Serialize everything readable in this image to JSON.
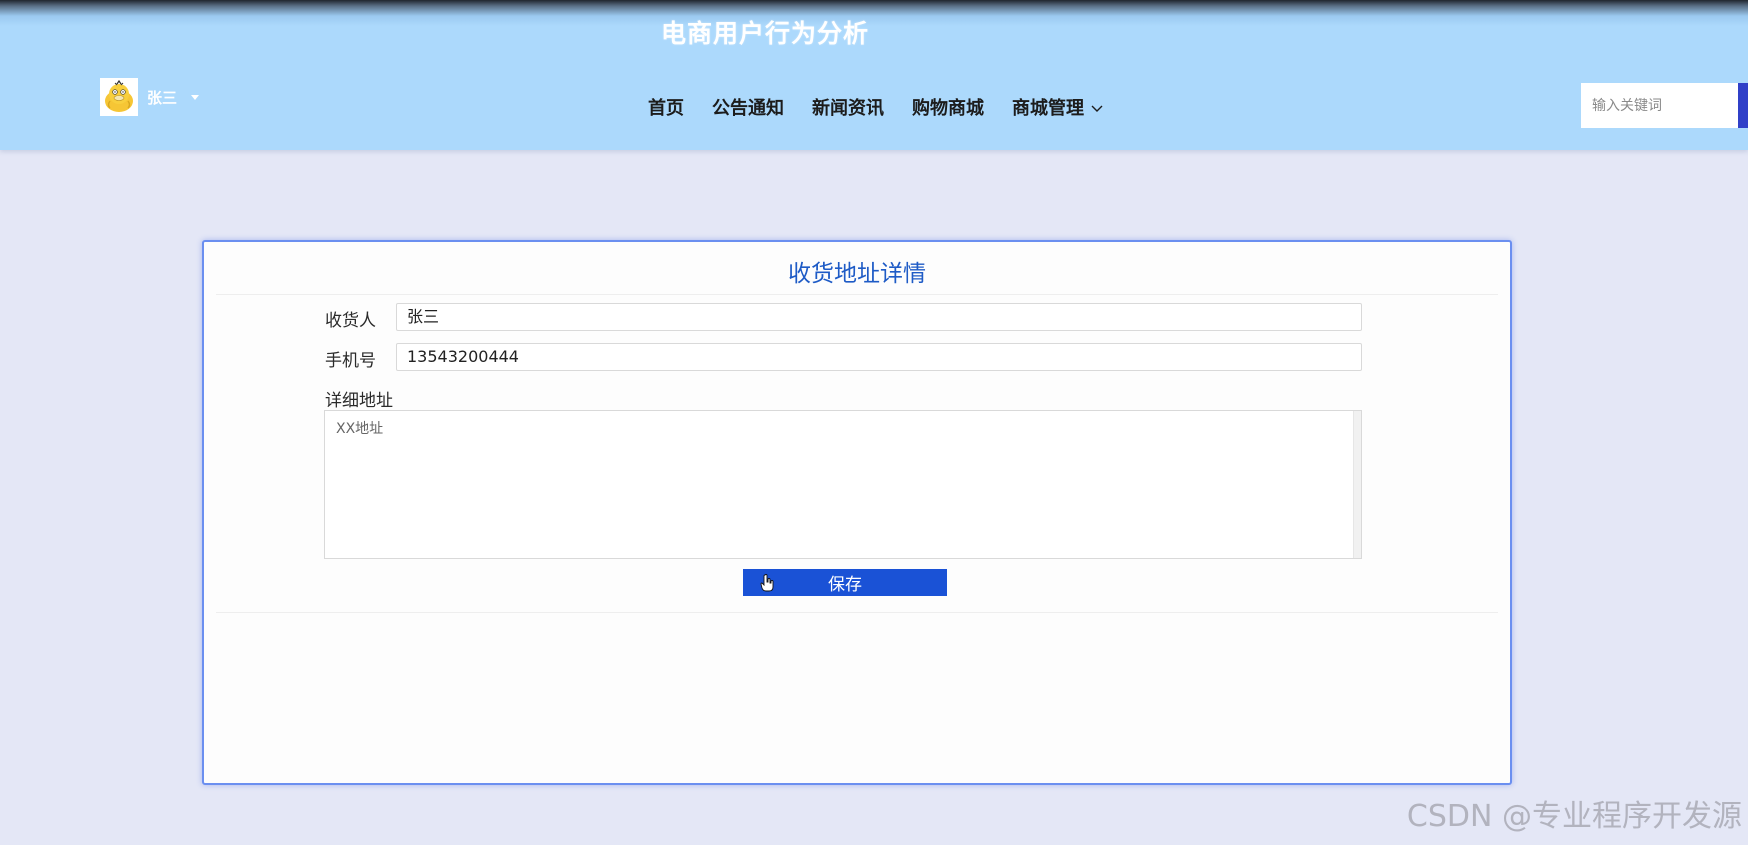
{
  "header": {
    "site_title": "电商用户行为分析",
    "user": {
      "name": "张三",
      "avatar_icon": "duck-avatar-icon"
    },
    "nav": [
      {
        "label": "首页"
      },
      {
        "label": "公告通知"
      },
      {
        "label": "新闻资讯"
      },
      {
        "label": "购物商城"
      },
      {
        "label": "商城管理",
        "has_dropdown": true
      }
    ],
    "search": {
      "placeholder": "输入关键词",
      "value": ""
    }
  },
  "form": {
    "title": "收货地址详情",
    "fields": {
      "receiver": {
        "label": "收货人",
        "value": "张三"
      },
      "phone": {
        "label": "手机号",
        "value": "13543200444"
      },
      "address": {
        "label": "详细地址",
        "value": "XX地址"
      }
    },
    "save_label": "保存"
  },
  "watermark": "CSDN @专业程序开发源",
  "colors": {
    "header_bg": "#acd9fc",
    "page_bg": "#e4e7f6",
    "accent": "#1a52d6",
    "title_blue": "#1e5bc6",
    "card_border": "#6b8ff0"
  }
}
